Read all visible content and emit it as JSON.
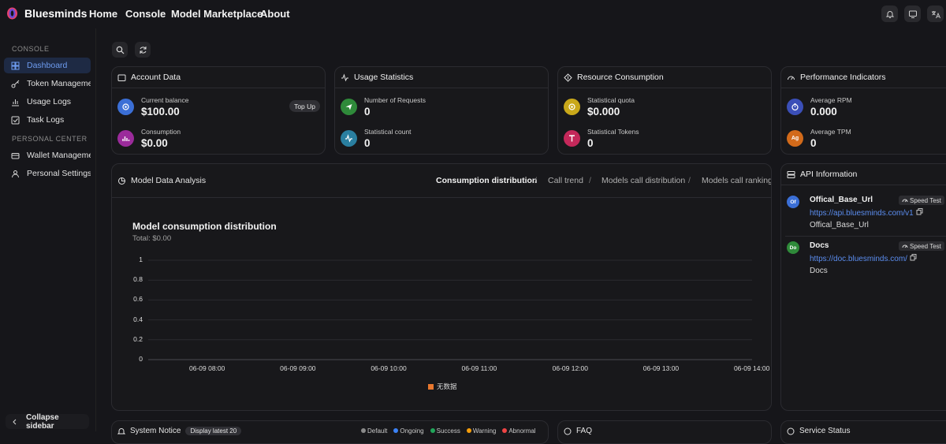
{
  "app": {
    "name": "Bluesminds"
  },
  "nav": [
    "Home",
    "Console",
    "Model Marketplace",
    "About"
  ],
  "sidebar": {
    "section_console": "CONSOLE",
    "console_items": [
      {
        "label": "Dashboard",
        "icon": "grid-icon",
        "active": true
      },
      {
        "label": "Token Management",
        "icon": "key-icon"
      },
      {
        "label": "Usage Logs",
        "icon": "bar-chart-icon"
      },
      {
        "label": "Task Logs",
        "icon": "task-check-icon"
      }
    ],
    "section_personal": "PERSONAL CENTER",
    "personal_items": [
      {
        "label": "Wallet Management",
        "icon": "wallet-icon"
      },
      {
        "label": "Personal Settings",
        "icon": "user-icon"
      }
    ],
    "collapse_label": "Collapse sidebar"
  },
  "account": {
    "title": "Account Data",
    "balance_label": "Current balance",
    "balance_value": "$100.00",
    "topup_label": "Top Up",
    "consumption_label": "Consumption",
    "consumption_value": "$0.00"
  },
  "usage": {
    "title": "Usage Statistics",
    "requests_label": "Number of Requests",
    "requests_value": "0",
    "count_label": "Statistical count",
    "count_value": "0"
  },
  "resource": {
    "title": "Resource Consumption",
    "quota_label": "Statistical quota",
    "quota_value": "$0.000",
    "tokens_label": "Statistical Tokens",
    "tokens_value": "0"
  },
  "performance": {
    "title": "Performance Indicators",
    "rpm_label": "Average RPM",
    "rpm_value": "0.000",
    "tpm_label": "Average TPM",
    "tpm_value": "0",
    "tpm_badge": "Ag"
  },
  "analysis": {
    "title": "Model Data Analysis",
    "tabs": [
      "Consumption distribution",
      "Call trend",
      "Models call distribution",
      "Models call ranking"
    ],
    "separator": "/"
  },
  "chart_data": {
    "type": "bar",
    "title": "Model consumption distribution",
    "subtitle": "Total:  $0.00",
    "categories": [
      "06-09 08:00",
      "06-09 09:00",
      "06-09 10:00",
      "06-09 11:00",
      "06-09 12:00",
      "06-09 13:00",
      "06-09 14:00"
    ],
    "series": [
      {
        "name": "无数据",
        "color": "#e8772e",
        "values": [
          0,
          0,
          0,
          0,
          0,
          0,
          0
        ]
      }
    ],
    "ylim": [
      0,
      1
    ],
    "yticks": [
      "1",
      "0.8",
      "0.6",
      "0.4",
      "0.2",
      "0"
    ],
    "grid": true,
    "legend_position": "bottom"
  },
  "api": {
    "title": "API Information",
    "items": [
      {
        "avatar": "Of",
        "avatar_color": "#3b6fd6",
        "name": "Offical_Base_Url",
        "url": "https://api.bluesminds.com/v1",
        "desc": "Offical_Base_Url",
        "speed_label": "Speed Test"
      },
      {
        "avatar": "Do",
        "avatar_color": "#2f8a3a",
        "name": "Docs",
        "url": "https://doc.bluesminds.com/",
        "desc": "Docs",
        "speed_label": "Speed Test"
      }
    ]
  },
  "bottom": {
    "notice_title": "System Notice",
    "notice_badge": "Display latest 20",
    "legend": [
      {
        "label": "Default",
        "color": "#8a8a8a"
      },
      {
        "label": "Ongoing",
        "color": "#3b82f6"
      },
      {
        "label": "Success",
        "color": "#22a55a"
      },
      {
        "label": "Warning",
        "color": "#f59e0b"
      },
      {
        "label": "Abnormal",
        "color": "#ef4444"
      }
    ],
    "faq_title": "FAQ",
    "service_title": "Service Status"
  }
}
